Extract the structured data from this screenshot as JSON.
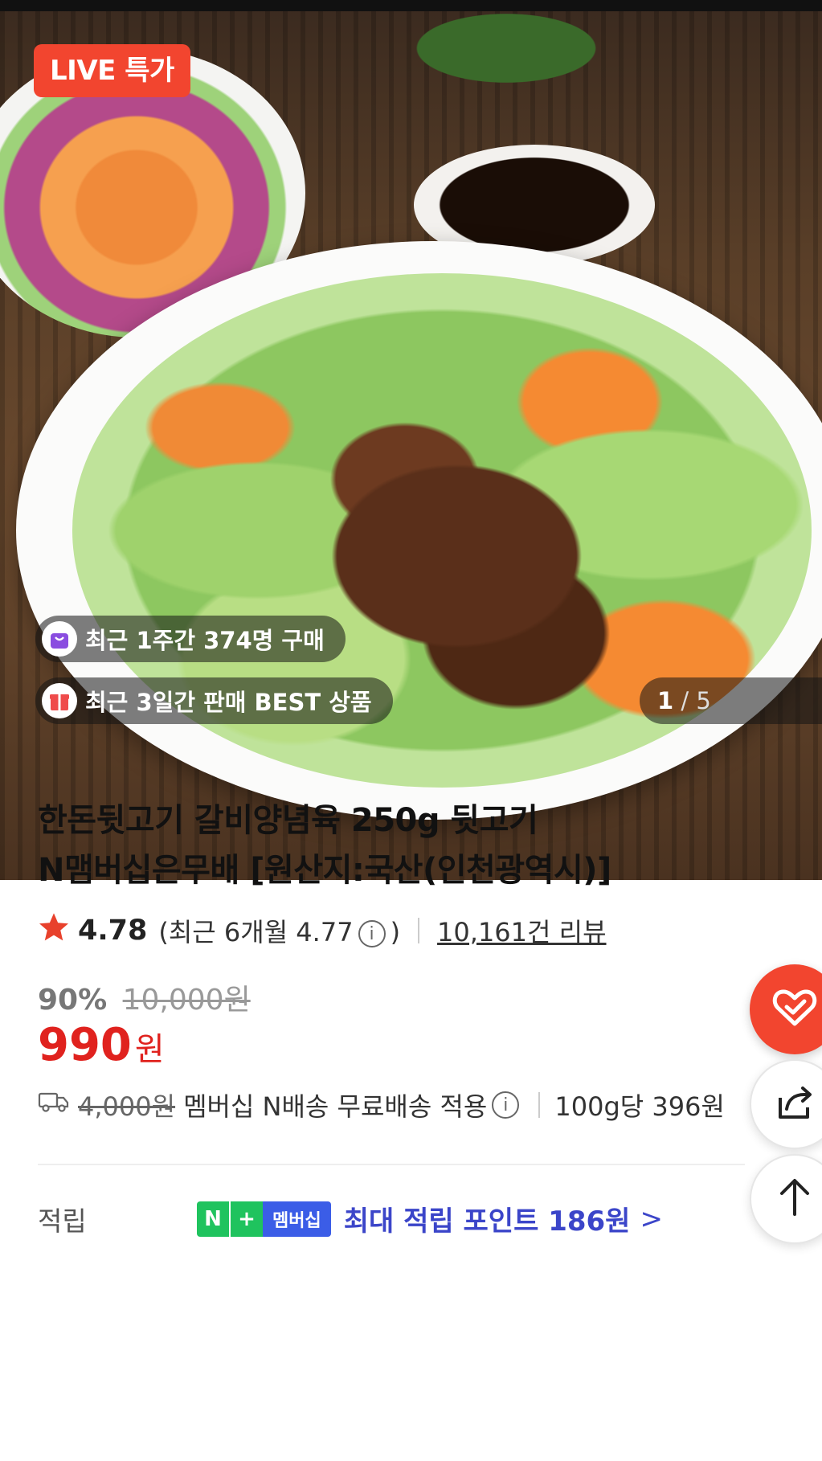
{
  "hero": {
    "live_badge": "LIVE 특가",
    "pill_purchases": "최근 1주간 374명 구매",
    "pill_best": "최근 3일간 판매 BEST 상품",
    "page_current": "1",
    "page_total": "/ 5"
  },
  "product": {
    "title_line1": "한돈뒷고기 갈비양념육 250g 뒷고기",
    "title_line2": "N맴버십은무배 [원산지:국산(인천광역시)]",
    "rating": "4.78",
    "recent_rating_prefix": "(최근 6개월 4.77",
    "recent_rating_suffix": ")",
    "review_count": "10,161건 리뷰",
    "discount_pct": "90%",
    "original_price": "10,000원",
    "price": "990",
    "price_unit": "원"
  },
  "shipping": {
    "fee": "4,000원",
    "note": "멤버십 N배송 무료배송 적용",
    "unit_price": "100g당 396원"
  },
  "points": {
    "label": "적립",
    "badge_n": "N",
    "badge_plus": "+",
    "badge_membership": "멤버십",
    "text": "최대 적립 포인트 186원",
    "chevron": ">"
  },
  "icons": {
    "info": "i",
    "star_color": "#e8412c",
    "accent": "#f2452f",
    "price_color": "#e0221e",
    "points_color": "#3b45c9"
  }
}
